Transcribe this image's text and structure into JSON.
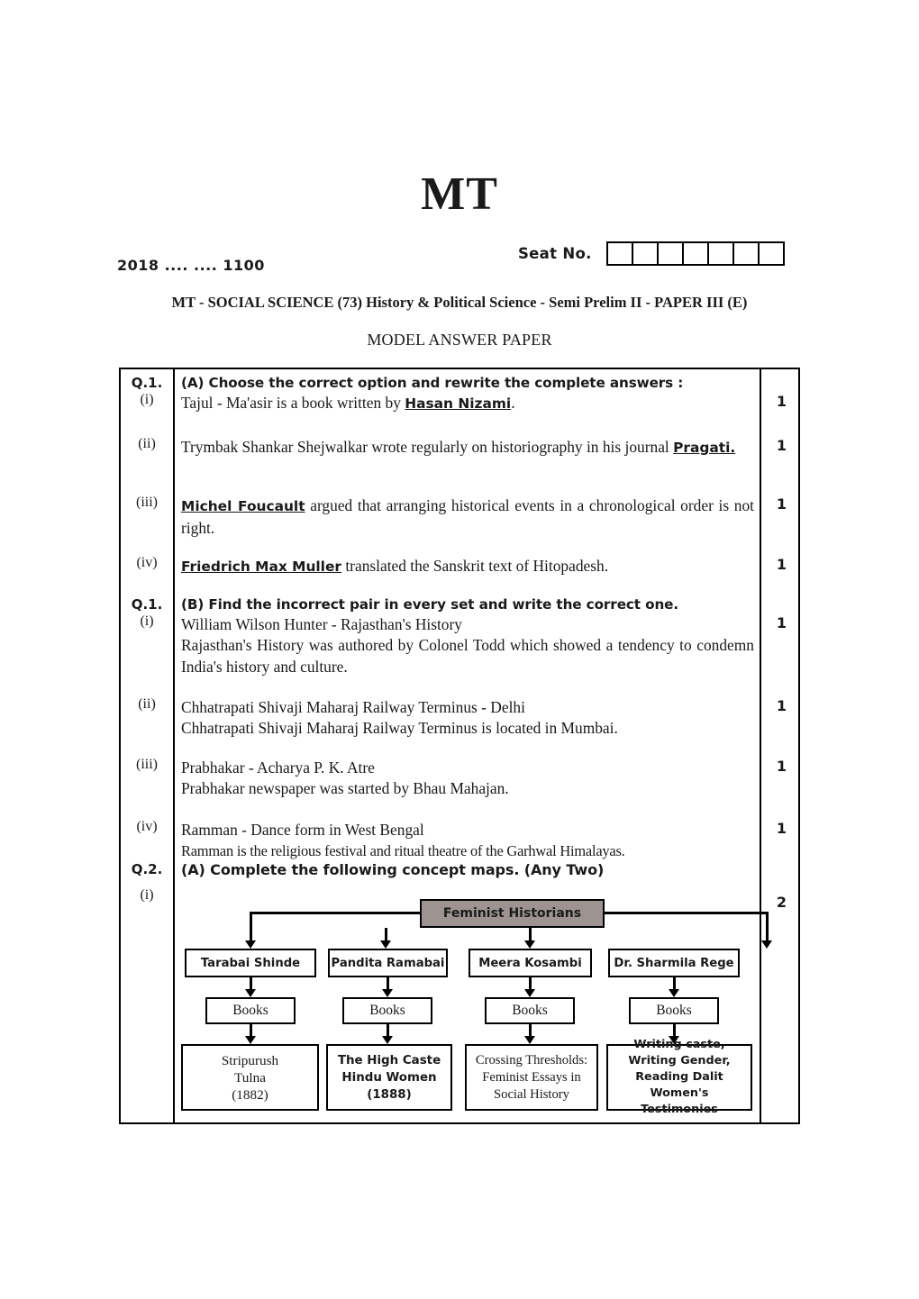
{
  "header": {
    "logo": "MT",
    "seat_label": "Seat No.",
    "seat_box_count": 7,
    "exam_code": "2018  ....  ....  1100",
    "subject_line": "MT - SOCIAL SCIENCE (73) History & Political Science - Semi Prelim II - PAPER III (E)",
    "model_answer_title": "MODEL ANSWER PAPER"
  },
  "questions": {
    "q1a": {
      "number": "Q.1.",
      "heading": "(A) Choose the correct option and rewrite the complete answers :",
      "items": [
        {
          "roman": "(i)",
          "pre": "Tajul - Ma'asir is a book written by ",
          "bold": "Hasan Nizami",
          "post": ".",
          "mark": "1"
        },
        {
          "roman": "(ii)",
          "pre": "Trymbak Shankar Shejwalkar wrote regularly on historiography in his journal ",
          "bold": "Pragati.",
          "post": "",
          "mark": "1"
        },
        {
          "roman": "(iii)",
          "pre": "",
          "bold": "Michel Foucault",
          "post": " argued that arranging historical events in a chronological order is not right.",
          "mark": "1"
        },
        {
          "roman": "(iv)",
          "pre": "",
          "bold": "Friedrich Max Muller",
          "post": " translated the Sanskrit text of Hitopadesh.",
          "mark": "1"
        }
      ]
    },
    "q1b": {
      "number": "Q.1.",
      "heading": "(B) Find the incorrect pair in every set and write the correct one.",
      "items": [
        {
          "roman": "(i)",
          "line1": "William Wilson Hunter - Rajasthan's History",
          "line2": "Rajasthan's History was authored by Colonel Todd which showed a tendency to condemn India's history and culture.",
          "mark": "1"
        },
        {
          "roman": "(ii)",
          "line1": "Chhatrapati Shivaji Maharaj Railway Terminus - Delhi",
          "line2": "Chhatrapati Shivaji Maharaj Railway Terminus is located in Mumbai.",
          "mark": "1"
        },
        {
          "roman": "(iii)",
          "line1": "Prabhakar - Acharya P. K. Atre",
          "line2": "Prabhakar newspaper was started by Bhau Mahajan.",
          "mark": "1"
        },
        {
          "roman": "(iv)",
          "line1": "Ramman - Dance form in West Bengal",
          "line2": "Ramman is the religious festival and ritual theatre of the Garhwal Himalayas.",
          "mark": "1"
        }
      ]
    },
    "q2a": {
      "number": "Q.2.",
      "heading": "(A) Complete the following concept maps. (Any Two)",
      "roman": "(i)",
      "mark": "2"
    }
  },
  "concept_map": {
    "root": "Feminist Historians",
    "root_fill": "#9d9492",
    "books_label": "Books",
    "branches": [
      {
        "name": "Tarabai Shinde",
        "books": "Books",
        "title_lines": [
          "Stripurush",
          "Tulna",
          "(1882)"
        ],
        "title_bold": false
      },
      {
        "name": "Pandita Ramabai",
        "books": "Books",
        "title_lines": [
          "The High Caste",
          "Hindu Women",
          "(1888)"
        ],
        "title_bold": true
      },
      {
        "name": "Meera Kosambi",
        "books": "Books",
        "title_lines": [
          "Crossing Thresholds:",
          "Feminist Essays in",
          "Social History"
        ],
        "title_bold": false
      },
      {
        "name": "Dr. Sharmila Rege",
        "books": "Books",
        "title_lines": [
          "Writing caste,",
          "Writing Gender,",
          "Reading Dalit",
          "Women's Testimonies"
        ],
        "title_bold": true
      }
    ]
  }
}
